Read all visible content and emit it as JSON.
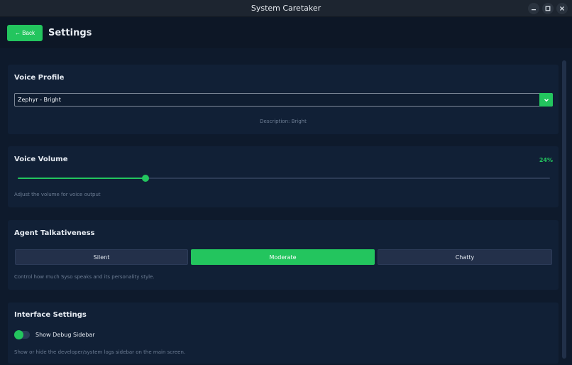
{
  "window": {
    "title": "System Caretaker",
    "controls": [
      "minimize-icon",
      "maximize-icon",
      "close-icon"
    ]
  },
  "header": {
    "back_label": "← Back",
    "title": "Settings"
  },
  "voice_profile": {
    "title": "Voice Profile",
    "selected": "Zephyr - Bright",
    "description": "Description: Bright"
  },
  "voice_volume": {
    "title": "Voice Volume",
    "percent_label": "24%",
    "value": 0.24,
    "help": "Adjust the volume for voice output"
  },
  "talkativeness": {
    "title": "Agent Talkativeness",
    "options": [
      "Silent",
      "Moderate",
      "Chatty"
    ],
    "selected_index": 1,
    "help": "Control how much Syso speaks and its personality style."
  },
  "interface": {
    "title": "Interface Settings",
    "debug_label": "Show Debug Sidebar",
    "debug_enabled": true,
    "help": "Show or hide the developer/system logs sidebar on the main screen."
  },
  "colors": {
    "accent": "#23c55e",
    "background": "#0e1a2c",
    "card": "#112036"
  }
}
